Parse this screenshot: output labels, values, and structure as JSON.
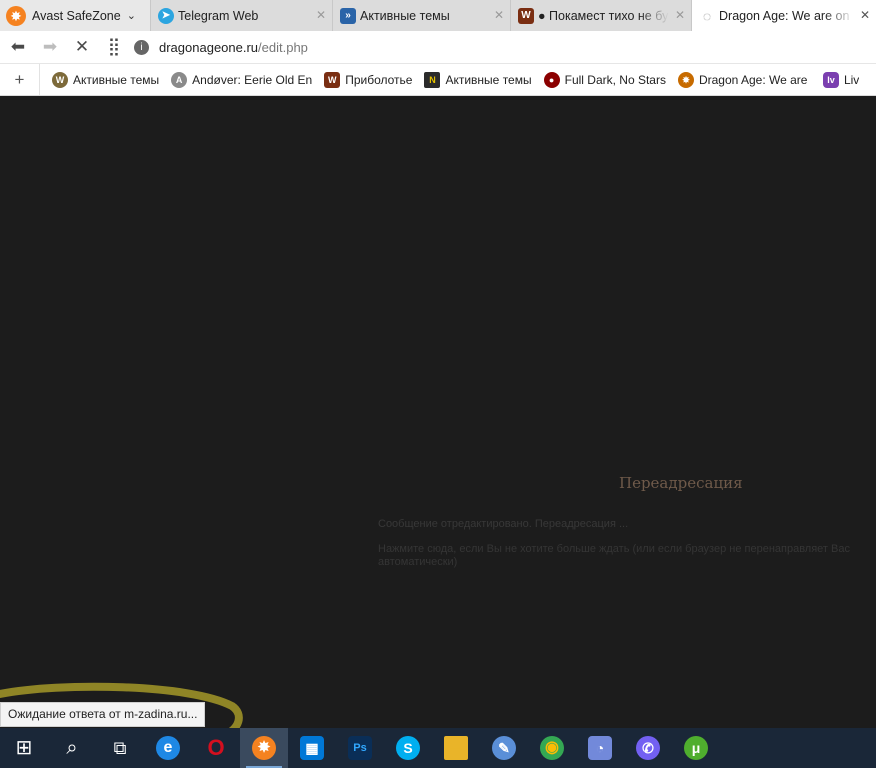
{
  "browser": {
    "brand_label": "Avast SafeZone",
    "tabs": [
      {
        "title": "Telegram Web",
        "favicon": "telegram-icon",
        "color": "#2ca5e0",
        "glyph": "➤"
      },
      {
        "title": "Активные темы",
        "favicon": "forum-icon",
        "color": "#2a64a8",
        "glyph": "»"
      },
      {
        "title": "● Покамест тихо не бу",
        "favicon": "game-icon",
        "color": "#7a2e12",
        "glyph": "W"
      },
      {
        "title": "Dragon Age: We are on",
        "favicon": "loading-spinner-icon",
        "color": "#ffffff",
        "glyph": "◌"
      }
    ]
  },
  "address_bar": {
    "host": "dragonageone.ru",
    "path": "/edit.php"
  },
  "bookmarks": [
    {
      "label": "Активные темы",
      "icon": "wow-icon",
      "color": "#7d6a3a",
      "glyph": "W"
    },
    {
      "label": "Andøver: Eerie Old En",
      "icon": "andover-icon",
      "color": "#8a8a8a",
      "glyph": "A"
    },
    {
      "label": "Приболотье",
      "icon": "game-icon",
      "color": "#7a2e12",
      "glyph": "W"
    },
    {
      "label": "Активные темы",
      "icon": "new-forum-icon",
      "color": "#2b2b2b",
      "glyph": "N"
    },
    {
      "label": "Full Dark, No Stars",
      "icon": "dark-icon",
      "color": "#8b0000",
      "glyph": "●"
    },
    {
      "label": "Dragon Age: We are o",
      "icon": "dragon-age-icon",
      "color": "#c76b00",
      "glyph": "✸"
    },
    {
      "label": "Liv",
      "icon": "liv-icon",
      "color": "#7b3fb0",
      "glyph": "lv"
    }
  ],
  "page": {
    "title": "Переадресация",
    "message": "Сообщение отредактировано. Переадресация ...",
    "link_text": "Нажмите сюда, если Вы не хотите больше ждать (или если браузер не перенаправляет Вас автоматически)"
  },
  "status_bar": {
    "text": "Ожидание ответа от m-zadina.ru..."
  },
  "taskbar": [
    {
      "name": "start-icon",
      "glyph": "⊞",
      "color": "transparent"
    },
    {
      "name": "search-icon",
      "glyph": "⌕",
      "color": "transparent"
    },
    {
      "name": "task-view-icon",
      "glyph": "⧉",
      "color": "transparent"
    },
    {
      "name": "edge-icon",
      "glyph": "e",
      "color": "#1e88e5"
    },
    {
      "name": "opera-icon",
      "glyph": "O",
      "color": "#d40f1f"
    },
    {
      "name": "avast-browser-icon",
      "glyph": "✸",
      "color": "#f58220"
    },
    {
      "name": "store-icon",
      "glyph": "▦",
      "color": "#0078d7"
    },
    {
      "name": "photoshop-icon",
      "glyph": "Ps",
      "color": "#0a2e57"
    },
    {
      "name": "skype-icon",
      "glyph": "S",
      "color": "#00aff0"
    },
    {
      "name": "file-explorer-icon",
      "glyph": "▬",
      "color": "#e9b429"
    },
    {
      "name": "paint-icon",
      "glyph": "✎",
      "color": "#5a8fd8"
    },
    {
      "name": "chrome-icon",
      "glyph": "◉",
      "color": "#34a853"
    },
    {
      "name": "discord-icon",
      "glyph": "◔",
      "color": "#7289da"
    },
    {
      "name": "viber-icon",
      "glyph": "✆",
      "color": "#7360f2"
    },
    {
      "name": "utorrent-icon",
      "glyph": "μ",
      "color": "#4fae2e"
    }
  ]
}
